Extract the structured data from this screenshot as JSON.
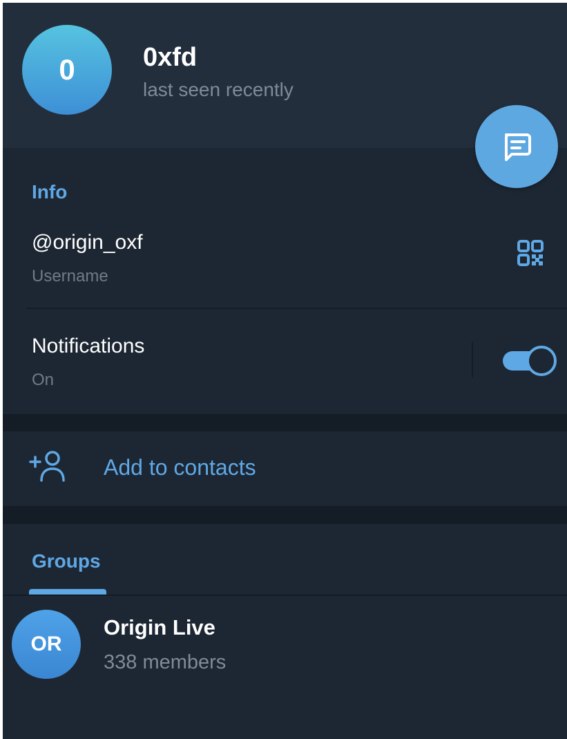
{
  "profile": {
    "avatar_letter": "0",
    "name": "0xfd",
    "status": "last seen recently"
  },
  "info": {
    "section_title": "Info",
    "username": "@origin_oxf",
    "username_label": "Username",
    "notifications_label": "Notifications",
    "notifications_value": "On",
    "notifications_enabled": true
  },
  "actions": {
    "add_to_contacts": "Add to contacts"
  },
  "tabs": {
    "groups": "Groups"
  },
  "groups": [
    {
      "avatar_initials": "OR",
      "name": "Origin Live",
      "members": "338 members"
    }
  ],
  "colors": {
    "background": "#1d2733",
    "header": "#232e3c",
    "accent": "#5fa8e6",
    "fab": "#5ea8e2"
  },
  "icons": {
    "fab": "message-icon",
    "username": "qr-code-icon",
    "contacts": "add-user-icon"
  }
}
